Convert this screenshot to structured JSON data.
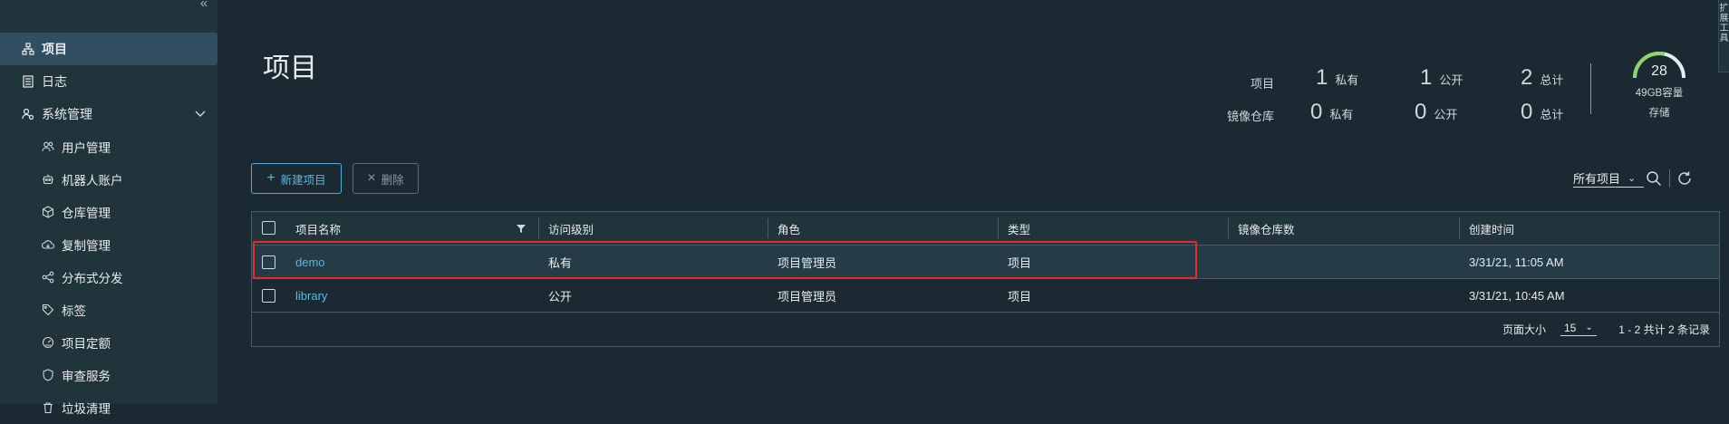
{
  "sidebar": {
    "items": [
      {
        "label": "项目",
        "icon": "projects-icon"
      },
      {
        "label": "日志",
        "icon": "log-icon"
      },
      {
        "label": "系统管理",
        "icon": "admin-icon"
      },
      {
        "label": "用户管理",
        "icon": "users-icon"
      },
      {
        "label": "机器人账户",
        "icon": "robot-icon"
      },
      {
        "label": "仓库管理",
        "icon": "registry-icon"
      },
      {
        "label": "复制管理",
        "icon": "replication-icon"
      },
      {
        "label": "分布式分发",
        "icon": "distribution-icon"
      },
      {
        "label": "标签",
        "icon": "tag-icon"
      },
      {
        "label": "项目定额",
        "icon": "quota-icon"
      },
      {
        "label": "审查服务",
        "icon": "shield-icon"
      },
      {
        "label": "垃圾清理",
        "icon": "trash-icon"
      }
    ]
  },
  "side_tab": {
    "text": "扩展工具"
  },
  "page": {
    "title": "项目"
  },
  "stats": {
    "projects_label": "项目",
    "repos_label": "镜像仓库",
    "projects": {
      "private": "1",
      "public": "1",
      "total": "2"
    },
    "repos": {
      "private": "0",
      "public": "0",
      "total": "0"
    },
    "private_label": "私有",
    "public_label": "公开",
    "total_label": "总计"
  },
  "storage": {
    "value": "28",
    "capacity": "49GB容量",
    "label": "存储",
    "used_fraction": 0.57
  },
  "toolbar": {
    "new_label": "新建项目",
    "delete_label": "删除",
    "filter_value": "所有项目"
  },
  "table": {
    "columns": [
      "项目名称",
      "访问级别",
      "角色",
      "类型",
      "镜像仓库数",
      "创建时间"
    ],
    "rows": [
      {
        "name": "demo",
        "access": "私有",
        "role": "项目管理员",
        "type": "项目",
        "repos": "",
        "created": "3/31/21, 11:05 AM"
      },
      {
        "name": "library",
        "access": "公开",
        "role": "项目管理员",
        "type": "项目",
        "repos": "",
        "created": "3/31/21, 10:45 AM"
      }
    ]
  },
  "pagination": {
    "page_size_label": "页面大小",
    "page_size": "15",
    "info": "1 - 2 共计 2 条记录"
  },
  "colors": {
    "accent": "#57b8e0",
    "highlight": "#e42a2a",
    "gauge": "#8fd36e"
  }
}
